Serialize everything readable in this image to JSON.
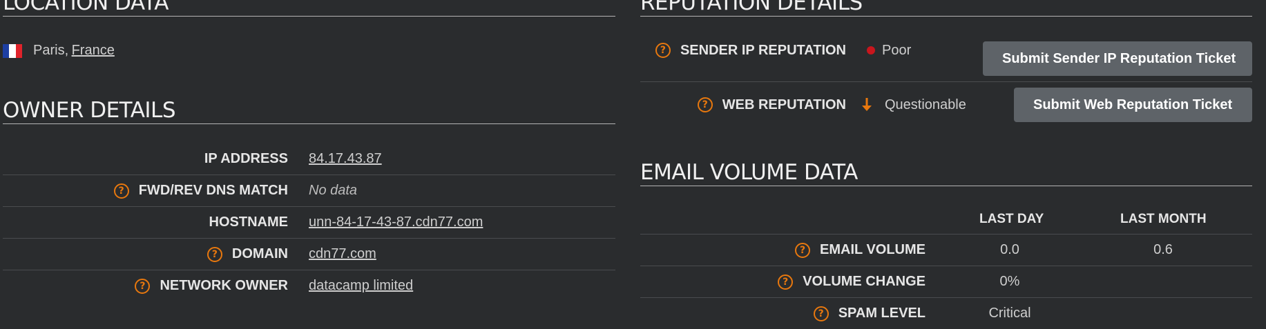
{
  "location": {
    "title": "LOCATION DATA",
    "city": "Paris,",
    "country": "France",
    "flag_colors": [
      "#1d3fa3",
      "#ffffff",
      "#e0232b"
    ]
  },
  "owner": {
    "title": "OWNER DETAILS",
    "rows": [
      {
        "label": "IP ADDRESS",
        "value": "84.17.43.87"
      },
      {
        "label": "FWD/REV DNS MATCH",
        "value": "No data"
      },
      {
        "label": "HOSTNAME",
        "value": "unn-84-17-43-87.cdn77.com"
      },
      {
        "label": "DOMAIN",
        "value": "cdn77.com"
      },
      {
        "label": "NETWORK OWNER",
        "value": "datacamp limited"
      }
    ]
  },
  "reputation": {
    "title": "REPUTATION DETAILS",
    "sender": {
      "label": "SENDER IP REPUTATION",
      "status": "Poor",
      "status_color": "#c8161d",
      "button": "Submit Sender IP Reputation Ticket"
    },
    "web": {
      "label": "WEB REPUTATION",
      "status": "Questionable",
      "status_color": "#e8780e",
      "button": "Submit Web Reputation Ticket"
    }
  },
  "email_volume": {
    "title": "EMAIL VOLUME DATA",
    "columns": [
      "LAST DAY",
      "LAST MONTH"
    ],
    "rows": [
      {
        "label": "EMAIL VOLUME",
        "last_day": "0.0",
        "last_month": "0.6"
      },
      {
        "label": "VOLUME CHANGE",
        "last_day": "0%",
        "last_month": ""
      },
      {
        "label": "SPAM LEVEL",
        "last_day": "Critical",
        "last_month": ""
      }
    ]
  },
  "help_glyph": "?",
  "colors": {
    "background": "#2a2c2e",
    "accent": "#e8780e",
    "button": "#5e6368"
  }
}
